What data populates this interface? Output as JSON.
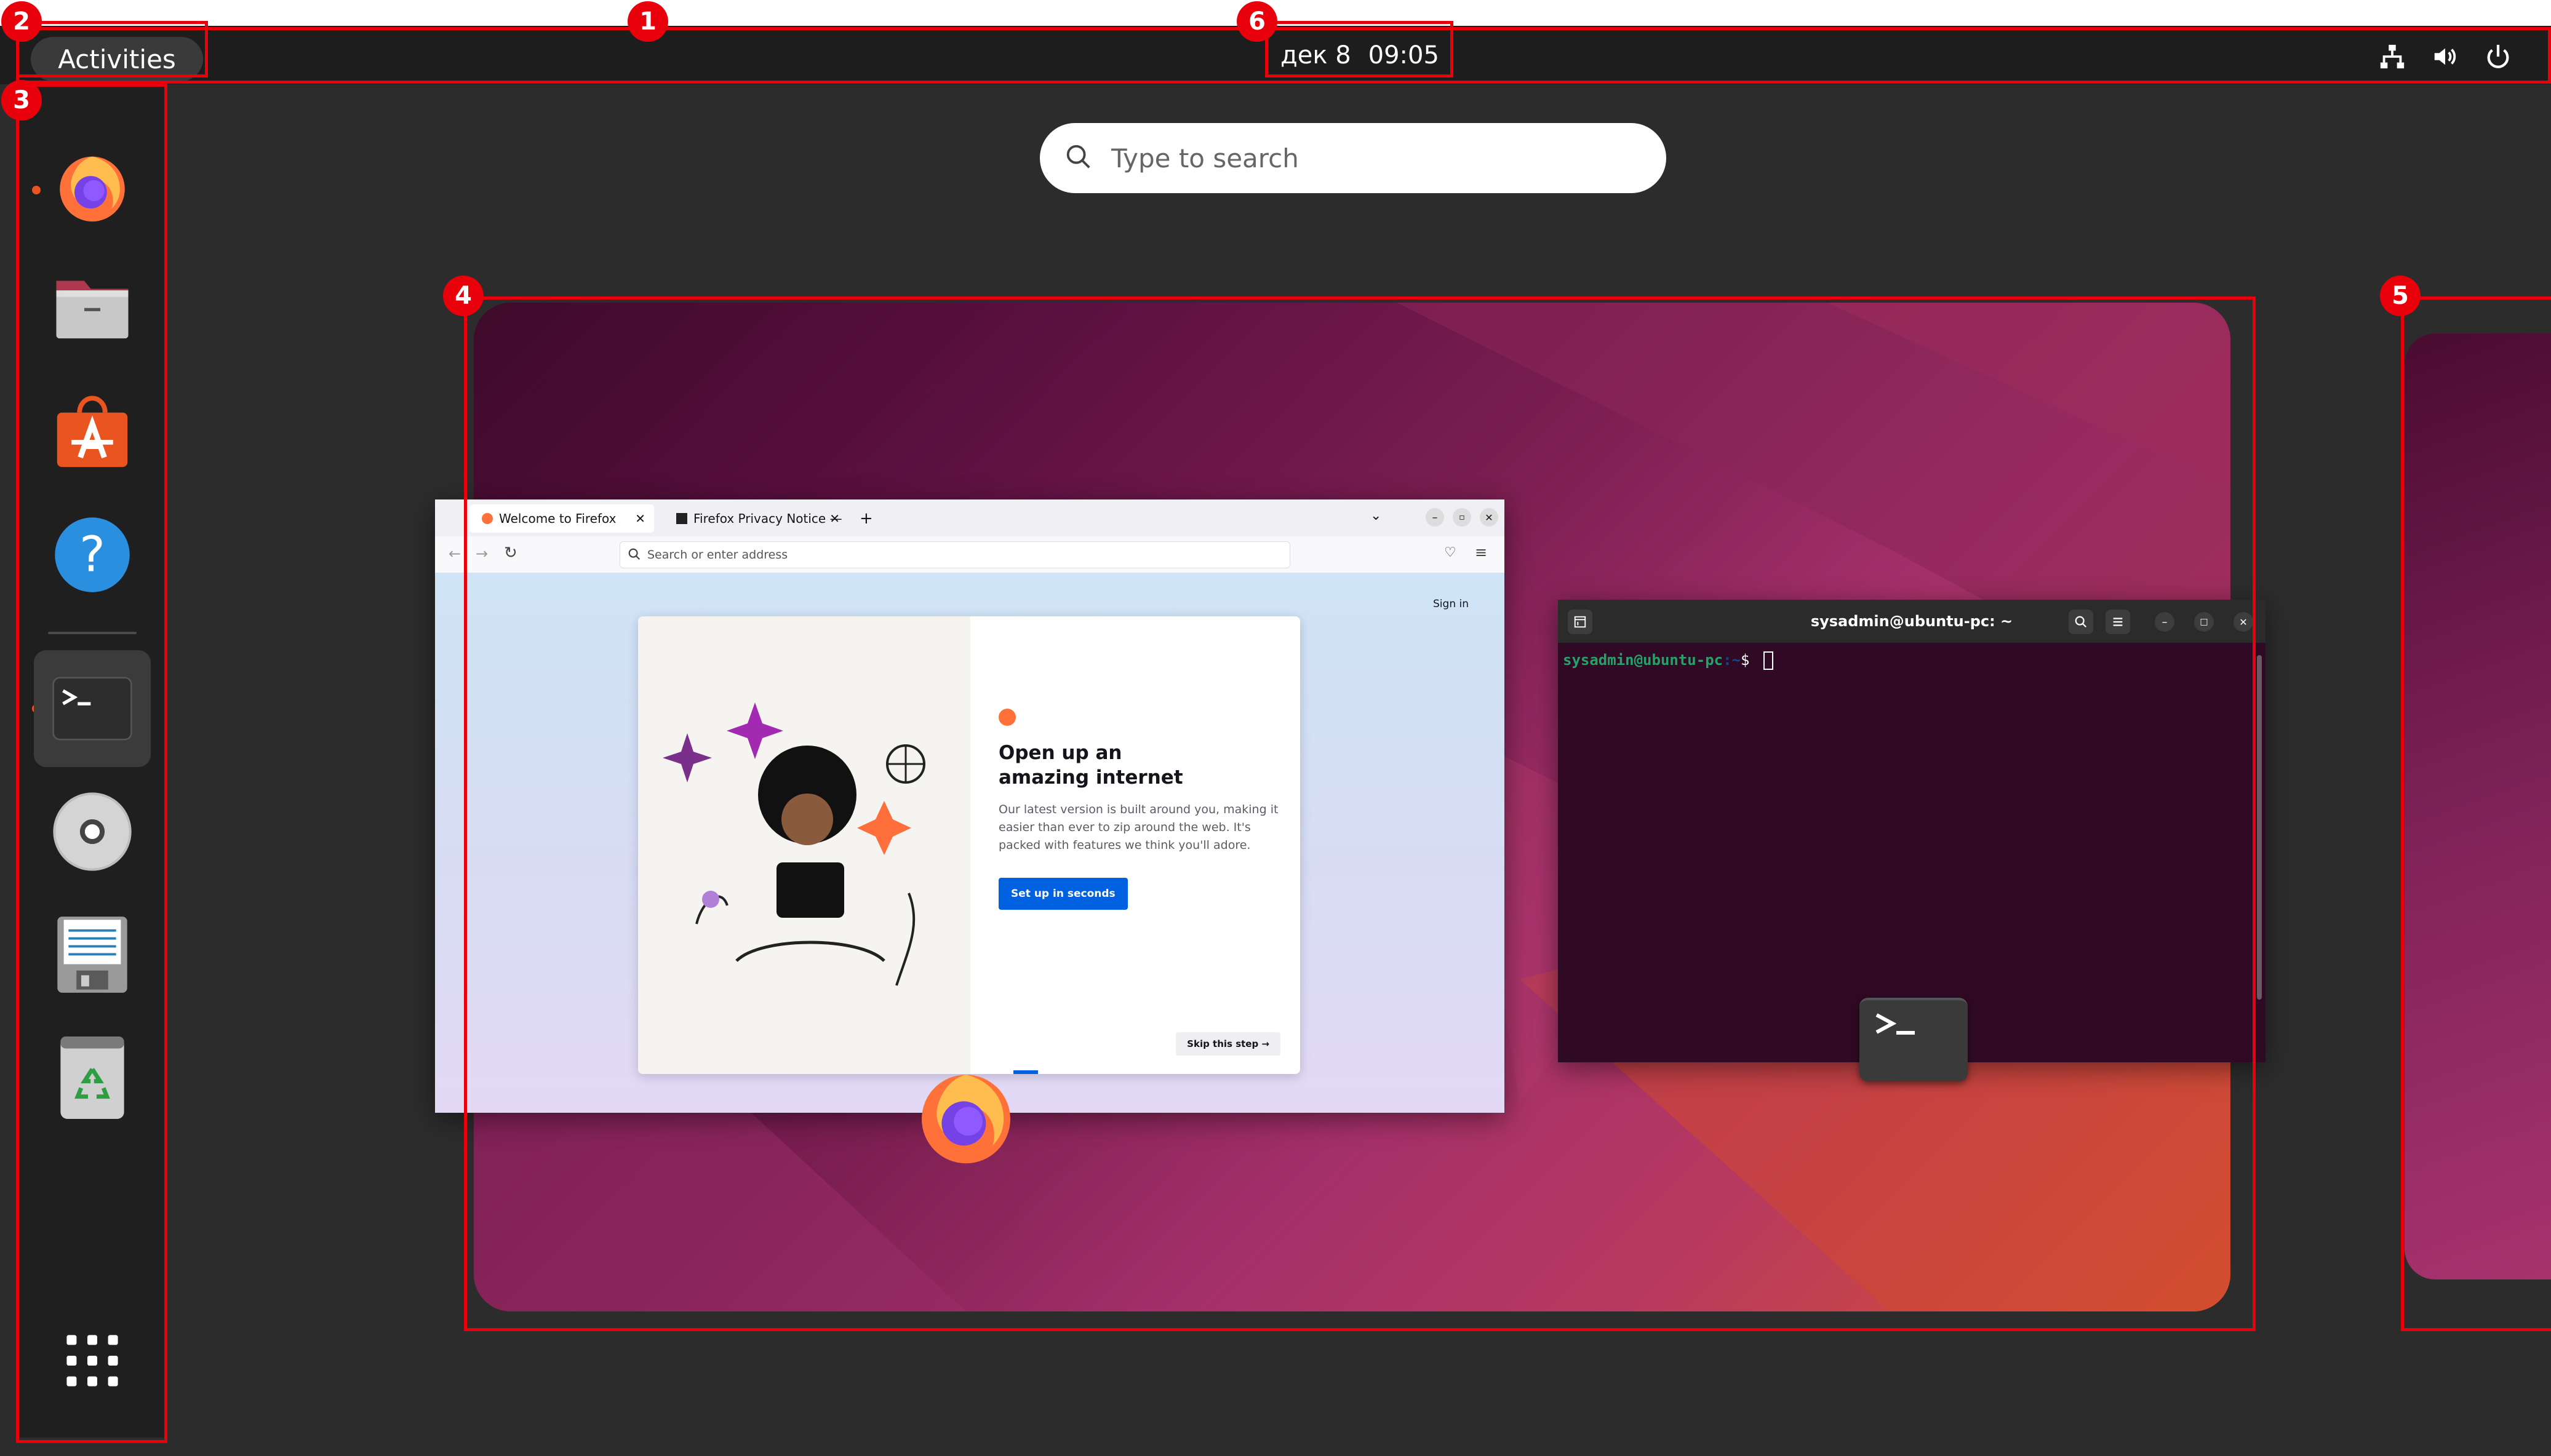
{
  "topbar": {
    "activities_label": "Activities",
    "date": "дек 8",
    "time": "09:05",
    "tray_icons": [
      "network-icon",
      "volume-icon",
      "power-icon"
    ]
  },
  "dash": {
    "items": [
      {
        "name": "firefox",
        "running": true
      },
      {
        "name": "files",
        "running": false
      },
      {
        "name": "app-center",
        "running": false
      },
      {
        "name": "help",
        "running": false
      },
      {
        "name": "terminal",
        "running": true
      },
      {
        "name": "disc",
        "running": false
      },
      {
        "name": "text-editor",
        "running": false
      },
      {
        "name": "trash",
        "running": false
      }
    ],
    "show_apps_icon": "grid-icon"
  },
  "search": {
    "placeholder": "Type to search"
  },
  "firefox_window": {
    "tabs": [
      "Welcome to Firefox",
      "Firefox Privacy Notice —"
    ],
    "url_placeholder": "Search or enter address",
    "sign_in": "Sign in",
    "heading": "Open up an amazing internet",
    "body": "Our latest version is built around you, making it easier than ever to zip around the web. It's packed with features we think you'll adore.",
    "cta": "Set up in seconds",
    "skip": "Skip this step →"
  },
  "terminal_window": {
    "title": "sysadmin@ubuntu-pc: ~",
    "prompt_user": "sysadmin@ubuntu-pc",
    "prompt_path": ":~",
    "prompt_symbol": "$"
  },
  "annotations": [
    "1",
    "2",
    "3",
    "4",
    "5",
    "6"
  ],
  "colors": {
    "accent": "#e95420",
    "annotation": "#e8000b",
    "terminal_bg": "#300a24",
    "firefox_blue": "#0061e0"
  }
}
